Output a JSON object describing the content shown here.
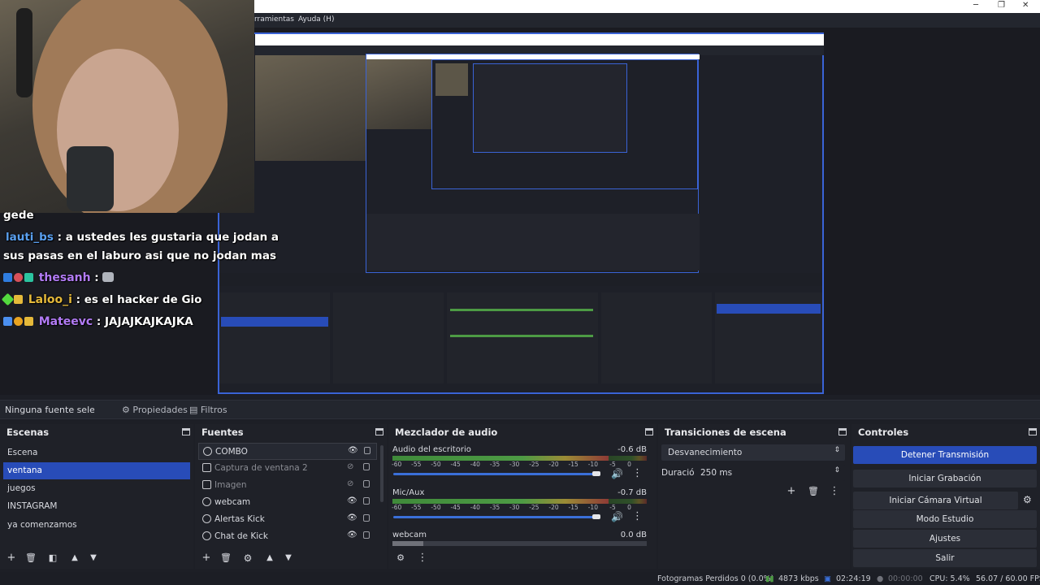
{
  "menu": {
    "items": [
      "rramientas",
      "Ayuda (H)"
    ]
  },
  "chat": {
    "lines": [
      {
        "user": "",
        "text": "gede",
        "color": "#ffffff"
      },
      {
        "user": "lauti_bs",
        "text": ": a ustedes les gustaria que jodan a",
        "color": "#5aa0f0"
      },
      {
        "user": "",
        "text": "sus pasas en el laburo asi que no jodan mas",
        "color": "#ffffff"
      },
      {
        "user": "thesanh",
        "text": ":",
        "color": "#b27bf5"
      },
      {
        "user": "Laloo_i",
        "text": ": es el hacker de Gio",
        "color": "#e5b93a"
      },
      {
        "user": "Mateevc",
        "text": ": JAJAJKAJKAJKA",
        "color": "#b27bf5"
      }
    ]
  },
  "propbar": {
    "no_source": "Ninguna fuente seleccionada",
    "properties": "Propiedades",
    "filters": "Filtros"
  },
  "scenes": {
    "title": "Escenas",
    "items": [
      "Escena",
      "ventana",
      "juegos",
      "INSTAGRAM",
      "ya comenzamos"
    ],
    "selected": 1
  },
  "sources": {
    "title": "Fuentes",
    "items": [
      {
        "name": "COMBO",
        "visible": true
      },
      {
        "name": "Captura de ventana 2",
        "visible": false
      },
      {
        "name": "Imagen",
        "visible": false
      },
      {
        "name": "webcam",
        "visible": true
      },
      {
        "name": "Alertas Kick",
        "visible": true
      },
      {
        "name": "Chat de Kick",
        "visible": true
      }
    ]
  },
  "mixer": {
    "title": "Mezclador de audio",
    "channels": [
      {
        "name": "Audio del escritorio",
        "db": "-0.6 dB",
        "level": 0.88
      },
      {
        "name": "Mic/Aux",
        "db": "-0.7 dB",
        "level": 0.88
      },
      {
        "name": "webcam",
        "db": "0.0 dB",
        "level": 0.12
      }
    ],
    "scale": [
      "-60",
      "-55",
      "-50",
      "-45",
      "-40",
      "-35",
      "-30",
      "-25",
      "-20",
      "-15",
      "-10",
      "-5",
      "0"
    ]
  },
  "transitions": {
    "title": "Transiciones de escena",
    "type": "Desvanecimiento",
    "duration_label": "Duración",
    "duration_value": "250 ms"
  },
  "controls": {
    "title": "Controles",
    "buttons": [
      "Detener Transmisión",
      "Iniciar Grabación",
      "Iniciar Cámara Virtual",
      "Modo Estudio",
      "Ajustes",
      "Salir"
    ]
  },
  "status": {
    "dropped": "Fotogramas Perdidos 0 (0.0%)",
    "bitrate": "4873 kbps",
    "stream_time": "02:24:19",
    "rec_time": "00:00:00",
    "cpu": "CPU: 5.4%",
    "fps": "56.07 / 60.00 FPS"
  },
  "colors": {
    "accent": "#284cb8",
    "panel": "#1f2128",
    "preview_border": "#3a63d6"
  }
}
